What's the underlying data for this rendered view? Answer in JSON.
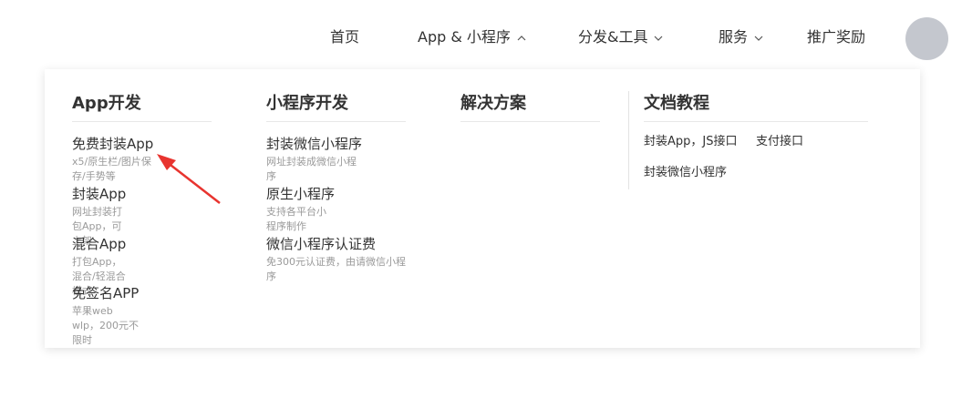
{
  "nav": {
    "home": "首页",
    "apps": "App & 小程序",
    "tools": "分发&工具",
    "services": "服务",
    "rewards": "推广奖励"
  },
  "dropdown": {
    "app_dev": {
      "title": "App开发",
      "items": [
        {
          "title": "免费封装App",
          "desc": "x5/原生栏/图片保存/手势等"
        },
        {
          "title": "封装App",
          "desc": "网址封装打包App，可上架"
        },
        {
          "title": "混合App",
          "desc": "打包App，混合/轻混合模式"
        },
        {
          "title": "免签名APP",
          "desc": "苹果web wlp，200元不限时"
        }
      ]
    },
    "mini_dev": {
      "title": "小程序开发",
      "items": [
        {
          "title": "封装微信小程序",
          "desc": "网址封装成微信小程序"
        },
        {
          "title": "原生小程序",
          "desc": "支持各平台小程序制作"
        },
        {
          "title": "微信小程序认证费",
          "desc": "免300元认证费，由请微信小程序"
        }
      ]
    },
    "solutions": {
      "title": "解决方案"
    },
    "docs": {
      "title": "文档教程",
      "links": [
        "封装App，JS接口",
        "支付接口",
        "封装微信小程序"
      ]
    }
  },
  "colors": {
    "annotation_arrow": "#e8342f",
    "avatar": "#c4c7ce"
  }
}
